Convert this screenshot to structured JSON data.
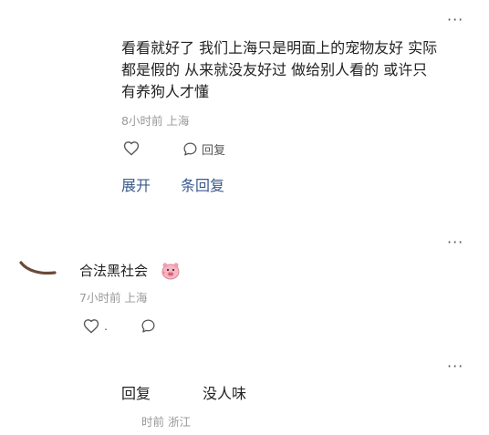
{
  "comment1": {
    "text_lines": [
      "看看就好了 我们上海只是明面上的宠物友好 实际",
      "都是假的 从来就没友好过 做给别人看的 或许只",
      "有养狗人才懂"
    ],
    "meta": "8小时前 上海",
    "like_count": "",
    "reply_label": "回复",
    "expand_label": "展开",
    "reply_count_label": "条回复",
    "more": "···"
  },
  "comment2": {
    "username": "合法黑社会",
    "meta": "7小时前 上海",
    "like_count": ".",
    "more": "···"
  },
  "comment3": {
    "reply_label": "回复",
    "text": "没人味",
    "meta": "时前 浙江",
    "more": "···"
  },
  "icons": {
    "like": "heart-outline-icon",
    "reply": "speech-bubble-icon",
    "sticker": "pig-face-sticker-icon",
    "avatar": "curved-stroke-avatar"
  }
}
